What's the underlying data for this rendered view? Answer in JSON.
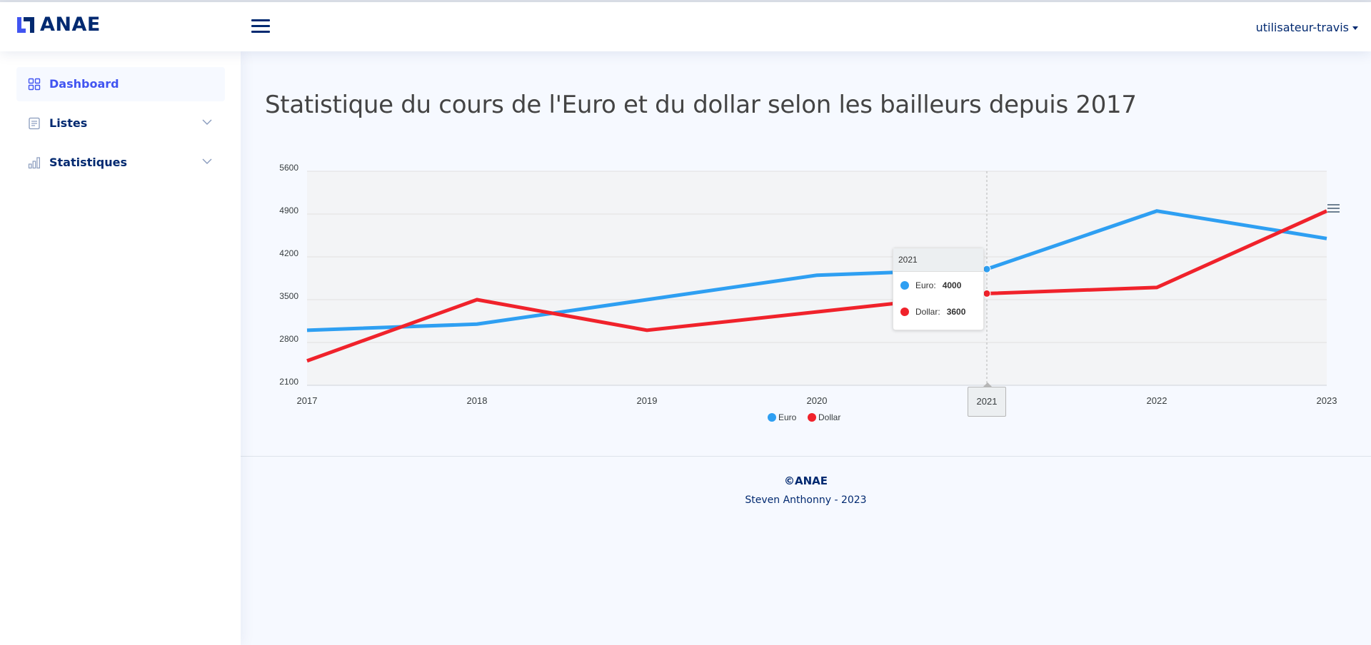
{
  "header": {
    "brand": "ANAE",
    "user": "utilisateur-travis"
  },
  "sidebar": {
    "items": [
      {
        "label": "Dashboard",
        "icon": "grid-icon",
        "active": true
      },
      {
        "label": "Listes",
        "icon": "list-icon",
        "active": false
      },
      {
        "label": "Statistiques",
        "icon": "bar-chart-icon",
        "active": false
      }
    ]
  },
  "main": {
    "title": "Statistique du cours de l'Euro et du dollar selon les bailleurs depuis 2017"
  },
  "tooltip": {
    "category": "2021",
    "rows": [
      {
        "name": "Euro:",
        "value": "4000"
      },
      {
        "name": "Dollar:",
        "value": "3600"
      }
    ]
  },
  "footer": {
    "brand": "©ANAE",
    "copy": "Steven Anthonny - 2023"
  },
  "colors": {
    "euro": "#2e9ff2",
    "dollar": "#f0222b",
    "brand": "#012970",
    "accent": "#4154f1"
  },
  "chart_data": {
    "type": "line",
    "categories": [
      "2017",
      "2018",
      "2019",
      "2020",
      "2021",
      "2022",
      "2023"
    ],
    "series": [
      {
        "name": "Euro",
        "values": [
          3000,
          3100,
          3500,
          3900,
          4000,
          4950,
          4500
        ]
      },
      {
        "name": "Dollar",
        "values": [
          2500,
          3500,
          3000,
          3300,
          3600,
          3700,
          4950
        ]
      }
    ],
    "yticks": [
      "5600",
      "4900",
      "4200",
      "3500",
      "2800",
      "2100"
    ],
    "ylim": [
      2100,
      5600
    ],
    "grid": true,
    "legend": "bottom-center"
  }
}
